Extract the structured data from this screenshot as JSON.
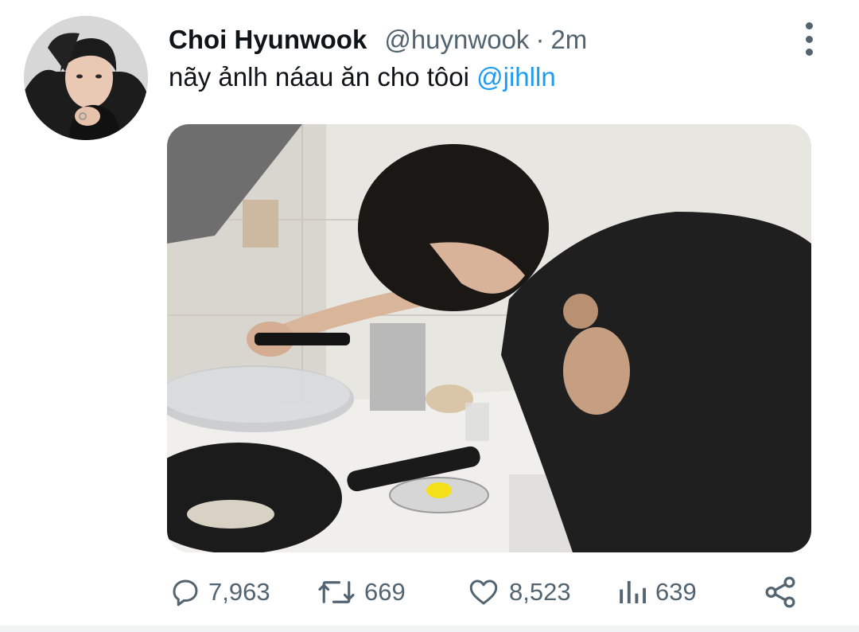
{
  "tweet": {
    "display_name": "Choi Hyunwook",
    "handle": "@huynwook",
    "separator": "·",
    "time": "2m",
    "text": "nãy ảnlh náau ăn cho tôoi ",
    "mention": "@jihlln"
  },
  "icons": {
    "more": "more-vertical-icon",
    "reply": "reply-bubble-icon",
    "retweet": "retweet-icon",
    "like": "heart-icon",
    "views": "bar-chart-icon",
    "share": "share-icon"
  },
  "actions": {
    "replies": "7,963",
    "retweets": "669",
    "likes": "8,523",
    "views": "639"
  },
  "colors": {
    "text": "#0f1419",
    "secondary": "#536471",
    "mention": "#1d9bf0"
  }
}
